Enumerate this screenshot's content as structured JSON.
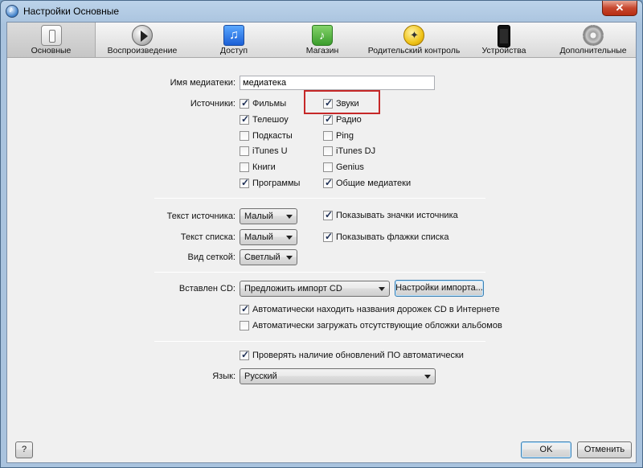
{
  "window": {
    "title": "Настройки Основные",
    "close_glyph": "✕"
  },
  "toolbar": {
    "items": [
      {
        "label": "Основные",
        "icon": "general-switch-icon"
      },
      {
        "label": "Воспроизведение",
        "icon": "play-icon"
      },
      {
        "label": "Доступ",
        "icon": "sharing-icon"
      },
      {
        "label": "Магазин",
        "icon": "store-bag-icon"
      },
      {
        "label": "Родительский контроль",
        "icon": "parental-control-icon"
      },
      {
        "label": "Устройства",
        "icon": "device-phone-icon"
      },
      {
        "label": "Дополнительные",
        "icon": "gear-icon"
      }
    ],
    "active_index": 0
  },
  "library": {
    "label": "Имя медиатеки:",
    "value": "медиатека"
  },
  "sources": {
    "label": "Источники:",
    "left": [
      {
        "label": "Фильмы",
        "checked": true
      },
      {
        "label": "Телешоу",
        "checked": true
      },
      {
        "label": "Подкасты",
        "checked": false
      },
      {
        "label": "iTunes U",
        "checked": false
      },
      {
        "label": "Книги",
        "checked": false
      },
      {
        "label": "Программы",
        "checked": true
      }
    ],
    "right": [
      {
        "label": "Звуки",
        "checked": true
      },
      {
        "label": "Радио",
        "checked": true
      },
      {
        "label": "Ping",
        "checked": false
      },
      {
        "label": "iTunes DJ",
        "checked": false
      },
      {
        "label": "Genius",
        "checked": false
      },
      {
        "label": "Общие медиатеки",
        "checked": true
      }
    ],
    "highlight_color": "#c62828"
  },
  "display": {
    "source_text": {
      "label": "Текст источника:",
      "value": "Малый"
    },
    "list_text": {
      "label": "Текст списка:",
      "value": "Малый"
    },
    "grid_view": {
      "label": "Вид сеткой:",
      "value": "Светлый"
    },
    "show_source_icons": {
      "label": "Показывать значки источника",
      "checked": true
    },
    "show_list_checkboxes": {
      "label": "Показывать флажки списка",
      "checked": true
    }
  },
  "cd": {
    "label": "Вставлен CD:",
    "value": "Предложить импорт CD",
    "import_settings_button": "Настройки импорта...",
    "auto_find_names": {
      "label": "Автоматически находить названия дорожек CD в Интернете",
      "checked": true
    },
    "auto_download_art": {
      "label": "Автоматически загружать отсутствующие обложки альбомов",
      "checked": false
    }
  },
  "updates": {
    "label": "Проверять наличие обновлений ПО автоматически",
    "checked": true
  },
  "language": {
    "label": "Язык:",
    "value": "Русский"
  },
  "footer": {
    "help": "?",
    "ok": "OK",
    "cancel": "Отменить"
  }
}
